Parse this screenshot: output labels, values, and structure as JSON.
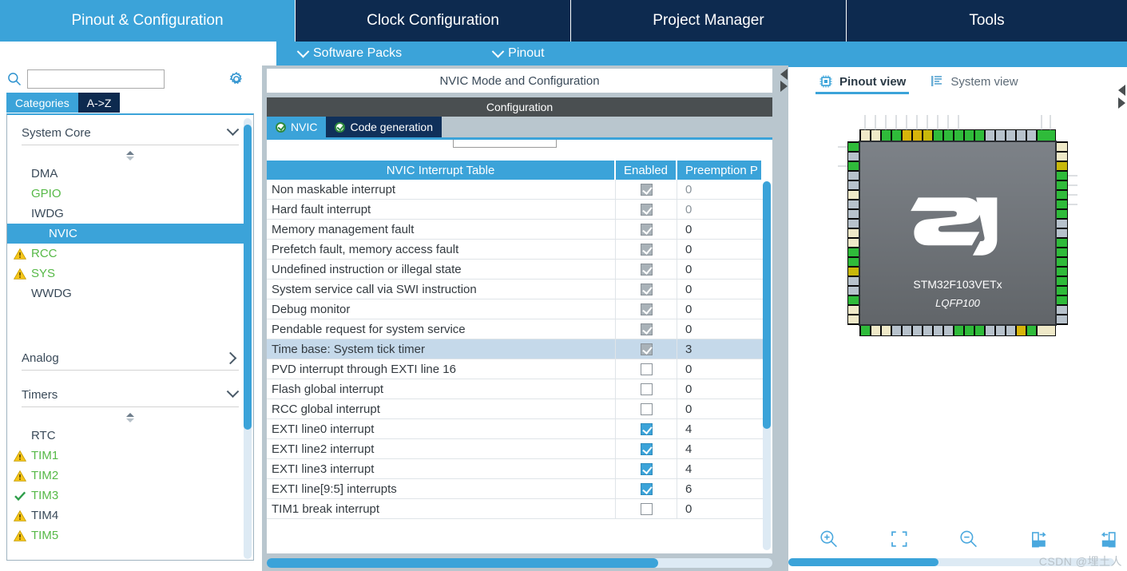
{
  "topbar": {
    "tabs": [
      {
        "label": "Pinout & Configuration",
        "active": true
      },
      {
        "label": "Clock Configuration",
        "active": false
      },
      {
        "label": "Project Manager",
        "active": false
      },
      {
        "label": "Tools",
        "active": false
      }
    ]
  },
  "subbar": {
    "software_packs": "Software Packs",
    "pinout": "Pinout"
  },
  "sidebar": {
    "search": {
      "value": "",
      "placeholder": ""
    },
    "tabs": [
      {
        "label": "Categories",
        "active": true
      },
      {
        "label": "A->Z",
        "active": false
      }
    ],
    "groups": [
      {
        "title": "System Core",
        "expanded": true,
        "items": [
          {
            "label": "DMA",
            "status": "none",
            "selected": false
          },
          {
            "label": "GPIO",
            "status": "ok-green-text",
            "selected": false
          },
          {
            "label": "IWDG",
            "status": "none",
            "selected": false
          },
          {
            "label": "NVIC",
            "status": "none",
            "selected": true
          },
          {
            "label": "RCC",
            "status": "warn",
            "selected": false
          },
          {
            "label": "SYS",
            "status": "warn",
            "selected": false
          },
          {
            "label": "WWDG",
            "status": "none",
            "selected": false
          }
        ]
      },
      {
        "title": "Analog",
        "expanded": false,
        "items": []
      },
      {
        "title": "Timers",
        "expanded": true,
        "items": [
          {
            "label": "RTC",
            "status": "none",
            "selected": false
          },
          {
            "label": "TIM1",
            "status": "warn",
            "selected": false
          },
          {
            "label": "TIM2",
            "status": "warn",
            "selected": false
          },
          {
            "label": "TIM3",
            "status": "check",
            "selected": false
          },
          {
            "label": "TIM4",
            "status": "warn",
            "selected": false
          },
          {
            "label": "TIM5",
            "status": "warn",
            "selected": false
          }
        ]
      }
    ]
  },
  "center": {
    "mode_header": "NVIC Mode and Configuration",
    "configuration_header": "Configuration",
    "tabs": [
      {
        "label": "NVIC",
        "active": true
      },
      {
        "label": "Code generation",
        "active": false
      }
    ],
    "table": {
      "columns": [
        "NVIC Interrupt Table",
        "Enabled",
        "Preemption P"
      ],
      "rows": [
        {
          "name": "Non maskable interrupt",
          "enabled": "locked",
          "priority": "0",
          "dim": true,
          "highlight": false
        },
        {
          "name": "Hard fault interrupt",
          "enabled": "locked",
          "priority": "0",
          "dim": true,
          "highlight": false
        },
        {
          "name": "Memory management fault",
          "enabled": "locked",
          "priority": "0",
          "dim": false,
          "highlight": false
        },
        {
          "name": "Prefetch fault, memory access fault",
          "enabled": "locked",
          "priority": "0",
          "dim": false,
          "highlight": false
        },
        {
          "name": "Undefined instruction or illegal state",
          "enabled": "locked",
          "priority": "0",
          "dim": false,
          "highlight": false
        },
        {
          "name": "System service call via SWI instruction",
          "enabled": "locked",
          "priority": "0",
          "dim": false,
          "highlight": false
        },
        {
          "name": "Debug monitor",
          "enabled": "locked",
          "priority": "0",
          "dim": false,
          "highlight": false
        },
        {
          "name": "Pendable request for system service",
          "enabled": "locked",
          "priority": "0",
          "dim": false,
          "highlight": false
        },
        {
          "name": "Time base: System tick timer",
          "enabled": "locked",
          "priority": "3",
          "dim": false,
          "highlight": true
        },
        {
          "name": "PVD interrupt through EXTI line 16",
          "enabled": "off",
          "priority": "0",
          "dim": false,
          "highlight": false
        },
        {
          "name": "Flash global interrupt",
          "enabled": "off",
          "priority": "0",
          "dim": false,
          "highlight": false
        },
        {
          "name": "RCC global interrupt",
          "enabled": "off",
          "priority": "0",
          "dim": false,
          "highlight": false
        },
        {
          "name": "EXTI line0 interrupt",
          "enabled": "on",
          "priority": "4",
          "dim": false,
          "highlight": false
        },
        {
          "name": "EXTI line2 interrupt",
          "enabled": "on",
          "priority": "4",
          "dim": false,
          "highlight": false
        },
        {
          "name": "EXTI line3 interrupt",
          "enabled": "on",
          "priority": "4",
          "dim": false,
          "highlight": false
        },
        {
          "name": "EXTI line[9:5] interrupts",
          "enabled": "on",
          "priority": "6",
          "dim": false,
          "highlight": false
        },
        {
          "name": "TIM1 break interrupt",
          "enabled": "off",
          "priority": "0",
          "dim": false,
          "highlight": false
        }
      ]
    }
  },
  "right": {
    "view_tabs": [
      {
        "label": "Pinout view",
        "active": true
      },
      {
        "label": "System view",
        "active": false
      }
    ],
    "chip": {
      "part_number": "STM32F103VETx",
      "package": "LQFP100"
    },
    "toolbar": [
      {
        "name": "zoom-in"
      },
      {
        "name": "fit-to-screen"
      },
      {
        "name": "zoom-out"
      },
      {
        "name": "rotate-right"
      },
      {
        "name": "rotate-left"
      }
    ],
    "watermark": "CSDN @埋土人"
  },
  "colors": {
    "accent_blue": "#3ba3d9",
    "dark_navy": "#0d2a4f",
    "panel_grey": "#b9c6ce",
    "warn_yellow": "#f5c518",
    "ok_green": "#56b947",
    "row_highlight": "#c5d9ea"
  }
}
